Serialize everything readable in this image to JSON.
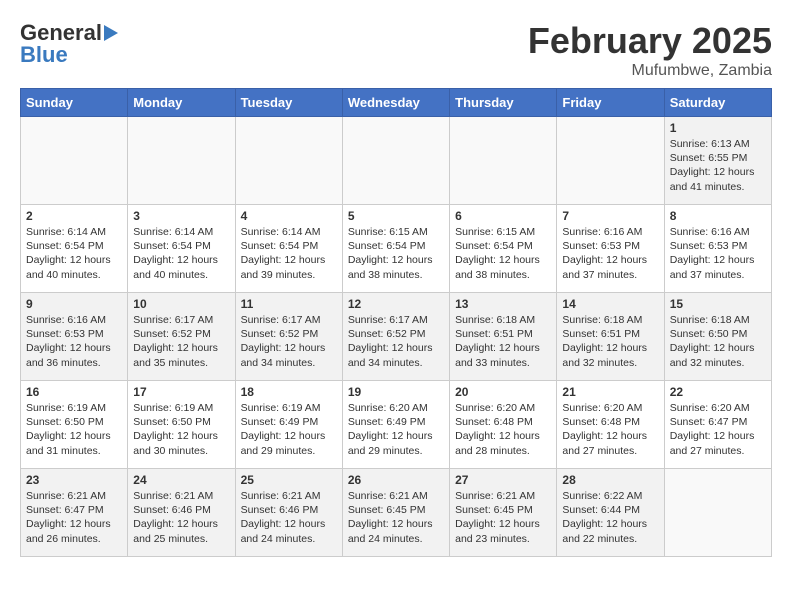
{
  "header": {
    "logo_general": "General",
    "logo_blue": "Blue",
    "title": "February 2025",
    "subtitle": "Mufumbwe, Zambia"
  },
  "weekdays": [
    "Sunday",
    "Monday",
    "Tuesday",
    "Wednesday",
    "Thursday",
    "Friday",
    "Saturday"
  ],
  "weeks": [
    [
      {
        "day": "",
        "info": ""
      },
      {
        "day": "",
        "info": ""
      },
      {
        "day": "",
        "info": ""
      },
      {
        "day": "",
        "info": ""
      },
      {
        "day": "",
        "info": ""
      },
      {
        "day": "",
        "info": ""
      },
      {
        "day": "1",
        "info": "Sunrise: 6:13 AM\nSunset: 6:55 PM\nDaylight: 12 hours and 41 minutes."
      }
    ],
    [
      {
        "day": "2",
        "info": "Sunrise: 6:14 AM\nSunset: 6:54 PM\nDaylight: 12 hours and 40 minutes."
      },
      {
        "day": "3",
        "info": "Sunrise: 6:14 AM\nSunset: 6:54 PM\nDaylight: 12 hours and 40 minutes."
      },
      {
        "day": "4",
        "info": "Sunrise: 6:14 AM\nSunset: 6:54 PM\nDaylight: 12 hours and 39 minutes."
      },
      {
        "day": "5",
        "info": "Sunrise: 6:15 AM\nSunset: 6:54 PM\nDaylight: 12 hours and 38 minutes."
      },
      {
        "day": "6",
        "info": "Sunrise: 6:15 AM\nSunset: 6:54 PM\nDaylight: 12 hours and 38 minutes."
      },
      {
        "day": "7",
        "info": "Sunrise: 6:16 AM\nSunset: 6:53 PM\nDaylight: 12 hours and 37 minutes."
      },
      {
        "day": "8",
        "info": "Sunrise: 6:16 AM\nSunset: 6:53 PM\nDaylight: 12 hours and 37 minutes."
      }
    ],
    [
      {
        "day": "9",
        "info": "Sunrise: 6:16 AM\nSunset: 6:53 PM\nDaylight: 12 hours and 36 minutes."
      },
      {
        "day": "10",
        "info": "Sunrise: 6:17 AM\nSunset: 6:52 PM\nDaylight: 12 hours and 35 minutes."
      },
      {
        "day": "11",
        "info": "Sunrise: 6:17 AM\nSunset: 6:52 PM\nDaylight: 12 hours and 34 minutes."
      },
      {
        "day": "12",
        "info": "Sunrise: 6:17 AM\nSunset: 6:52 PM\nDaylight: 12 hours and 34 minutes."
      },
      {
        "day": "13",
        "info": "Sunrise: 6:18 AM\nSunset: 6:51 PM\nDaylight: 12 hours and 33 minutes."
      },
      {
        "day": "14",
        "info": "Sunrise: 6:18 AM\nSunset: 6:51 PM\nDaylight: 12 hours and 32 minutes."
      },
      {
        "day": "15",
        "info": "Sunrise: 6:18 AM\nSunset: 6:50 PM\nDaylight: 12 hours and 32 minutes."
      }
    ],
    [
      {
        "day": "16",
        "info": "Sunrise: 6:19 AM\nSunset: 6:50 PM\nDaylight: 12 hours and 31 minutes."
      },
      {
        "day": "17",
        "info": "Sunrise: 6:19 AM\nSunset: 6:50 PM\nDaylight: 12 hours and 30 minutes."
      },
      {
        "day": "18",
        "info": "Sunrise: 6:19 AM\nSunset: 6:49 PM\nDaylight: 12 hours and 29 minutes."
      },
      {
        "day": "19",
        "info": "Sunrise: 6:20 AM\nSunset: 6:49 PM\nDaylight: 12 hours and 29 minutes."
      },
      {
        "day": "20",
        "info": "Sunrise: 6:20 AM\nSunset: 6:48 PM\nDaylight: 12 hours and 28 minutes."
      },
      {
        "day": "21",
        "info": "Sunrise: 6:20 AM\nSunset: 6:48 PM\nDaylight: 12 hours and 27 minutes."
      },
      {
        "day": "22",
        "info": "Sunrise: 6:20 AM\nSunset: 6:47 PM\nDaylight: 12 hours and 27 minutes."
      }
    ],
    [
      {
        "day": "23",
        "info": "Sunrise: 6:21 AM\nSunset: 6:47 PM\nDaylight: 12 hours and 26 minutes."
      },
      {
        "day": "24",
        "info": "Sunrise: 6:21 AM\nSunset: 6:46 PM\nDaylight: 12 hours and 25 minutes."
      },
      {
        "day": "25",
        "info": "Sunrise: 6:21 AM\nSunset: 6:46 PM\nDaylight: 12 hours and 24 minutes."
      },
      {
        "day": "26",
        "info": "Sunrise: 6:21 AM\nSunset: 6:45 PM\nDaylight: 12 hours and 24 minutes."
      },
      {
        "day": "27",
        "info": "Sunrise: 6:21 AM\nSunset: 6:45 PM\nDaylight: 12 hours and 23 minutes."
      },
      {
        "day": "28",
        "info": "Sunrise: 6:22 AM\nSunset: 6:44 PM\nDaylight: 12 hours and 22 minutes."
      },
      {
        "day": "",
        "info": ""
      }
    ]
  ]
}
